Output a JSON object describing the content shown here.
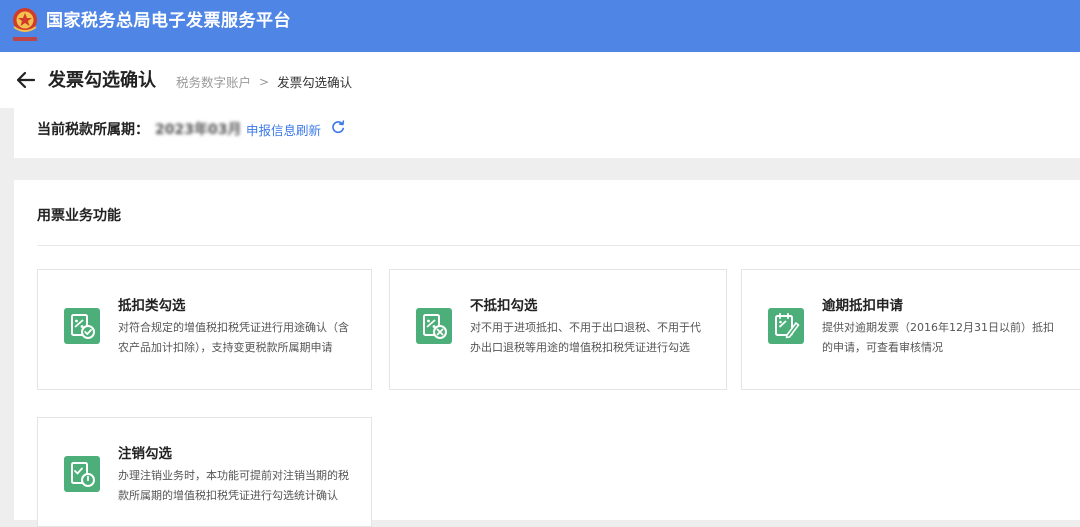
{
  "header": {
    "app_title": "国家税务总局电子发票服务平台"
  },
  "page": {
    "title": "发票勾选确认",
    "breadcrumb": [
      "税务数字账户",
      "发票勾选确认"
    ],
    "breadcrumb_separator": ">"
  },
  "tax_period": {
    "label": "当前税款所属期：",
    "value": "2023年03月",
    "refresh_link": "申报信息刷新"
  },
  "functions": {
    "section_title": "用票业务功能",
    "cards": [
      {
        "title": "抵扣类勾选",
        "description": "对符合规定的增值税扣税凭证进行用途确认（含农产品加计扣除），支持变更税款所属期申请",
        "icon": "deduction-select-icon"
      },
      {
        "title": "不抵扣勾选",
        "description": "对不用于进项抵扣、不用于出口退税、不用于代办出口退税等用途的增值税扣税凭证进行勾选",
        "icon": "non-deduction-select-icon"
      },
      {
        "title": "逾期抵扣申请",
        "description": "提供对逾期发票（2016年12月31日以前）抵扣的申请，可查看审核情况",
        "icon": "overdue-application-icon"
      },
      {
        "title": "注销勾选",
        "description": "办理注销业务时，本功能可提前对注销当期的税款所属期的增值税扣税凭证进行勾选统计确认",
        "icon": "cancellation-select-icon"
      }
    ]
  },
  "colors": {
    "header_bg": "#4f86e6",
    "icon_green": "#4cae78",
    "link_blue": "#3b79e8"
  }
}
